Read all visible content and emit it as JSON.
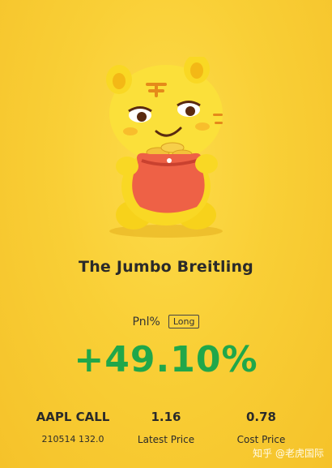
{
  "card": {
    "name": "The Jumbo Breitling",
    "pnl_label": "Pnl%",
    "position_type": "Long",
    "pnl_value": "+49.10%"
  },
  "details": {
    "instrument": "AAPL CALL",
    "contract": "210514 132.0",
    "latest_price": "1.16",
    "latest_price_label": "Latest Price",
    "cost_price": "0.78",
    "cost_price_label": "Cost Price"
  },
  "watermark": "知乎 @老虎国际",
  "colors": {
    "background": "#f7c62c",
    "gain": "#20a74a"
  },
  "icons": {
    "mascot": "tiger-mascot-with-money-bag"
  }
}
